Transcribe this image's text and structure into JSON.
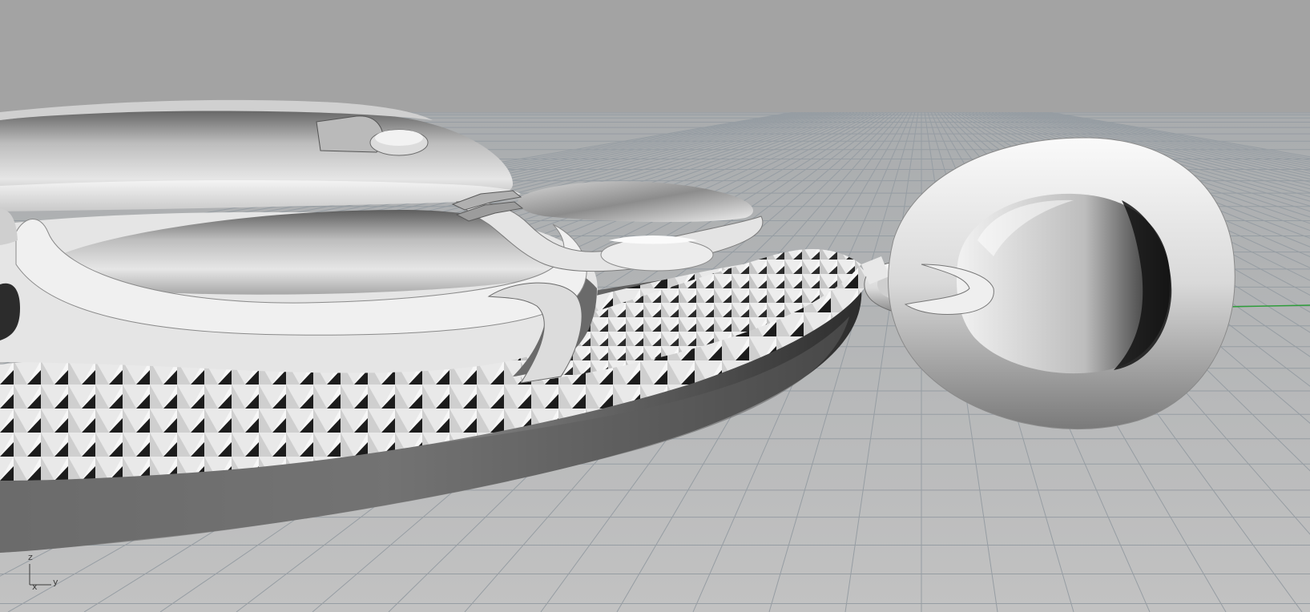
{
  "viewport": {
    "kind": "Perspective",
    "background_color": "#a3a3a3",
    "floor_color": "#b4b4b4",
    "grid_line_color": "#969da3",
    "y_axis_line_color": "#2e9d3a",
    "model_shade_light": "#f2f2f2",
    "model_shade_dark": "#141414"
  },
  "axis_indicator": {
    "z_label": "z",
    "x_label": "x",
    "y_label": "y"
  },
  "model": {
    "name": "pendant-with-bail-ring",
    "parts": [
      "pendant-body",
      "pyramid-stud-border",
      "domed-inlay",
      "jump-ring",
      "bail-loop"
    ]
  }
}
